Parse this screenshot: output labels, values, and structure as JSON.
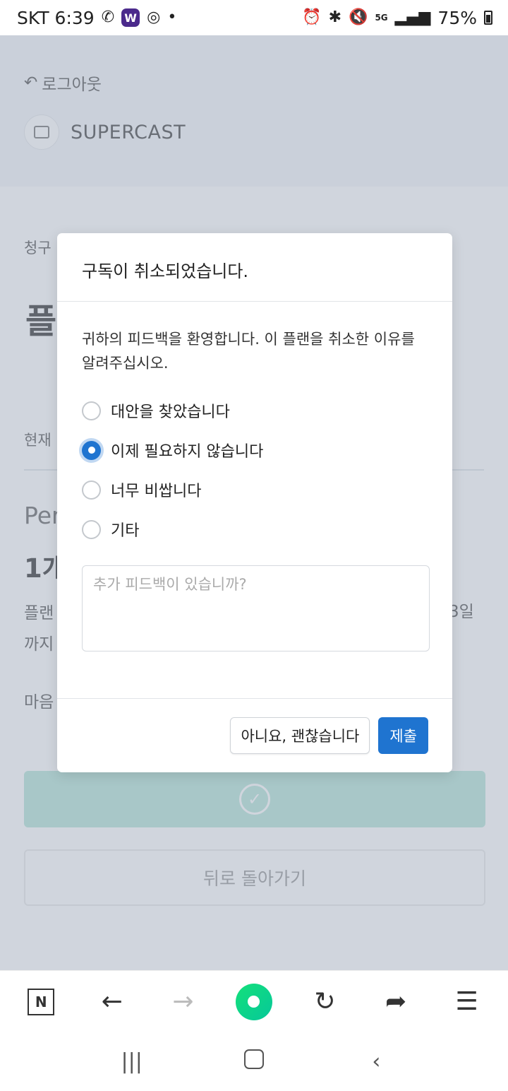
{
  "status_bar": {
    "carrier_time": "SKT 6:39",
    "battery": "75%",
    "network": "5G"
  },
  "page": {
    "logout_label": "로그아웃",
    "brand_name": "SUPERCAST",
    "billing_label": "청구",
    "plan_title_partial": "플",
    "current_label": "현재",
    "period_partial": "Per",
    "count_partial": "1개",
    "plan_line_1": "플랜",
    "plan_line_2": "까지",
    "date_fragment": "3일",
    "mind_label": "마음",
    "back_button": "뒤로 돌아가기"
  },
  "modal": {
    "title": "구독이 취소되었습니다.",
    "intro": "귀하의 피드백을 환영합니다. 이 플랜을 취소한 이유를 알려주십시오.",
    "options": [
      {
        "label": "대안을 찾았습니다",
        "checked": false
      },
      {
        "label": "이제 필요하지 않습니다",
        "checked": true
      },
      {
        "label": "너무 비쌉니다",
        "checked": false
      },
      {
        "label": "기타",
        "checked": false
      }
    ],
    "feedback_placeholder": "추가 피드백이 있습니까?",
    "feedback_value": "",
    "cancel_button": "아니요, 괜찮습니다",
    "submit_button": "제출"
  },
  "colors": {
    "primary": "#1f74d0",
    "confirm_green": "#b6e6d9",
    "overlay": "#96a2b4"
  }
}
